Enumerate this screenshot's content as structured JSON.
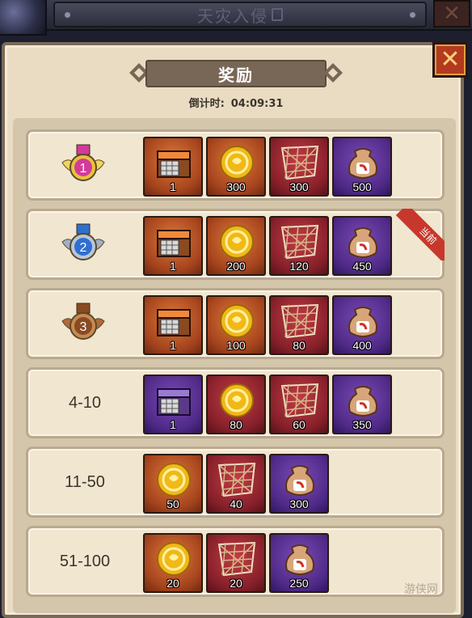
{
  "header": {
    "title": "天灾入侵"
  },
  "dialog": {
    "title": "奖励",
    "countdown_label": "倒计时:",
    "countdown_value": "04:09:31",
    "current_badge": "当前"
  },
  "colors": {
    "orange_slot": "#a4431d",
    "red_slot": "#86202a",
    "purple_slot": "#4f2a86",
    "panel": "#e9dcc2"
  },
  "rows": [
    {
      "rank": "1",
      "rank_label": "",
      "medal": "gold-medal-icon",
      "rewards": [
        {
          "icon": "orange-chest-icon",
          "rarity": "orange",
          "qty": "1"
        },
        {
          "icon": "gold-coin-icon",
          "rarity": "orange",
          "qty": "300"
        },
        {
          "icon": "net-icon",
          "rarity": "red",
          "qty": "300"
        },
        {
          "icon": "pouch-icon",
          "rarity": "purple",
          "qty": "500"
        }
      ]
    },
    {
      "rank": "2",
      "rank_label": "",
      "medal": "silver-medal-icon",
      "current": true,
      "rewards": [
        {
          "icon": "orange-chest-icon",
          "rarity": "orange",
          "qty": "1"
        },
        {
          "icon": "gold-coin-icon",
          "rarity": "orange",
          "qty": "200"
        },
        {
          "icon": "net-icon",
          "rarity": "red",
          "qty": "120"
        },
        {
          "icon": "pouch-icon",
          "rarity": "purple",
          "qty": "450"
        }
      ]
    },
    {
      "rank": "3",
      "rank_label": "",
      "medal": "bronze-medal-icon",
      "rewards": [
        {
          "icon": "orange-chest-icon",
          "rarity": "orange",
          "qty": "1"
        },
        {
          "icon": "gold-coin-icon",
          "rarity": "orange",
          "qty": "100"
        },
        {
          "icon": "net-icon",
          "rarity": "red",
          "qty": "80"
        },
        {
          "icon": "pouch-icon",
          "rarity": "purple",
          "qty": "400"
        }
      ]
    },
    {
      "rank_label": "4-10",
      "rewards": [
        {
          "icon": "purple-chest-icon",
          "rarity": "purple",
          "qty": "1"
        },
        {
          "icon": "gold-coin-icon",
          "rarity": "red",
          "qty": "80"
        },
        {
          "icon": "net-icon",
          "rarity": "red",
          "qty": "60"
        },
        {
          "icon": "pouch-icon",
          "rarity": "purple",
          "qty": "350"
        }
      ]
    },
    {
      "rank_label": "11-50",
      "rewards": [
        {
          "icon": "gold-coin-icon",
          "rarity": "orange",
          "qty": "50"
        },
        {
          "icon": "net-icon",
          "rarity": "red",
          "qty": "40"
        },
        {
          "icon": "pouch-icon",
          "rarity": "purple",
          "qty": "300"
        }
      ]
    },
    {
      "rank_label": "51-100",
      "rewards": [
        {
          "icon": "gold-coin-icon",
          "rarity": "orange",
          "qty": "20"
        },
        {
          "icon": "net-icon",
          "rarity": "red",
          "qty": "20"
        },
        {
          "icon": "pouch-icon",
          "rarity": "purple",
          "qty": "250"
        }
      ]
    }
  ]
}
